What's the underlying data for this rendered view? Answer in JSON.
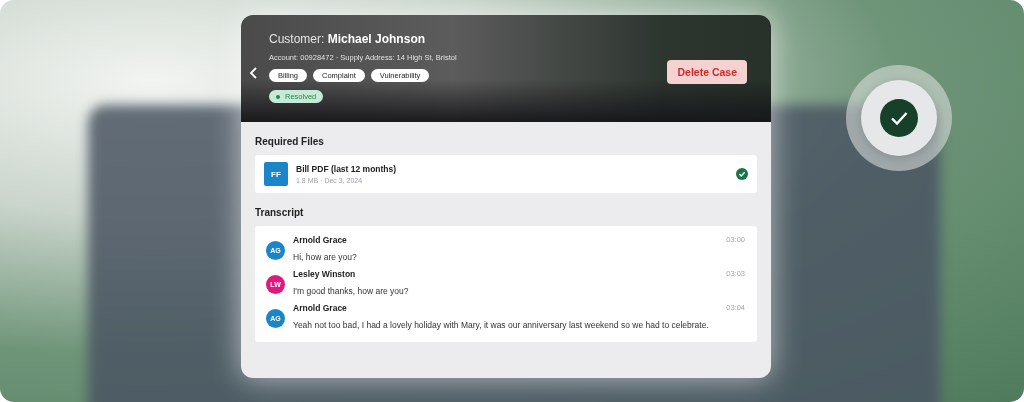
{
  "header": {
    "title": "Customer: **Michael Johnson**",
    "details": "Account: 00928472 · Supply Address: 14 High St, Bristol",
    "tags": [
      "Billing",
      "Complaint",
      "Vulnerability"
    ],
    "status": {
      "label": "Resolved",
      "color": "#1e8a4c"
    },
    "action": "Delete Case"
  },
  "required_files": {
    "title": "Required Files",
    "files": [
      {
        "initials": "FF",
        "name": "Bill PDF (last 12 months)",
        "meta": "1.8 MB · Dec 3, 2024",
        "verified": true
      }
    ]
  },
  "transcript": {
    "title": "Transcript",
    "messages": [
      {
        "initials": "AG",
        "color": "#1a86c9",
        "speaker": "Arnold Grace",
        "time": "03:00",
        "text": "Hi, how are you?"
      },
      {
        "initials": "LW",
        "color": "#e0197d",
        "speaker": "Lesley Winston",
        "time": "03:03",
        "text": "I'm good thanks, how are you?"
      },
      {
        "initials": "AG",
        "color": "#1a86c9",
        "speaker": "Arnold Grace",
        "time": "03:04",
        "text": "Yeah not too bad, I had a lovely holiday with Mary, it was our anniversary last weekend so we had to celebrate."
      }
    ]
  }
}
